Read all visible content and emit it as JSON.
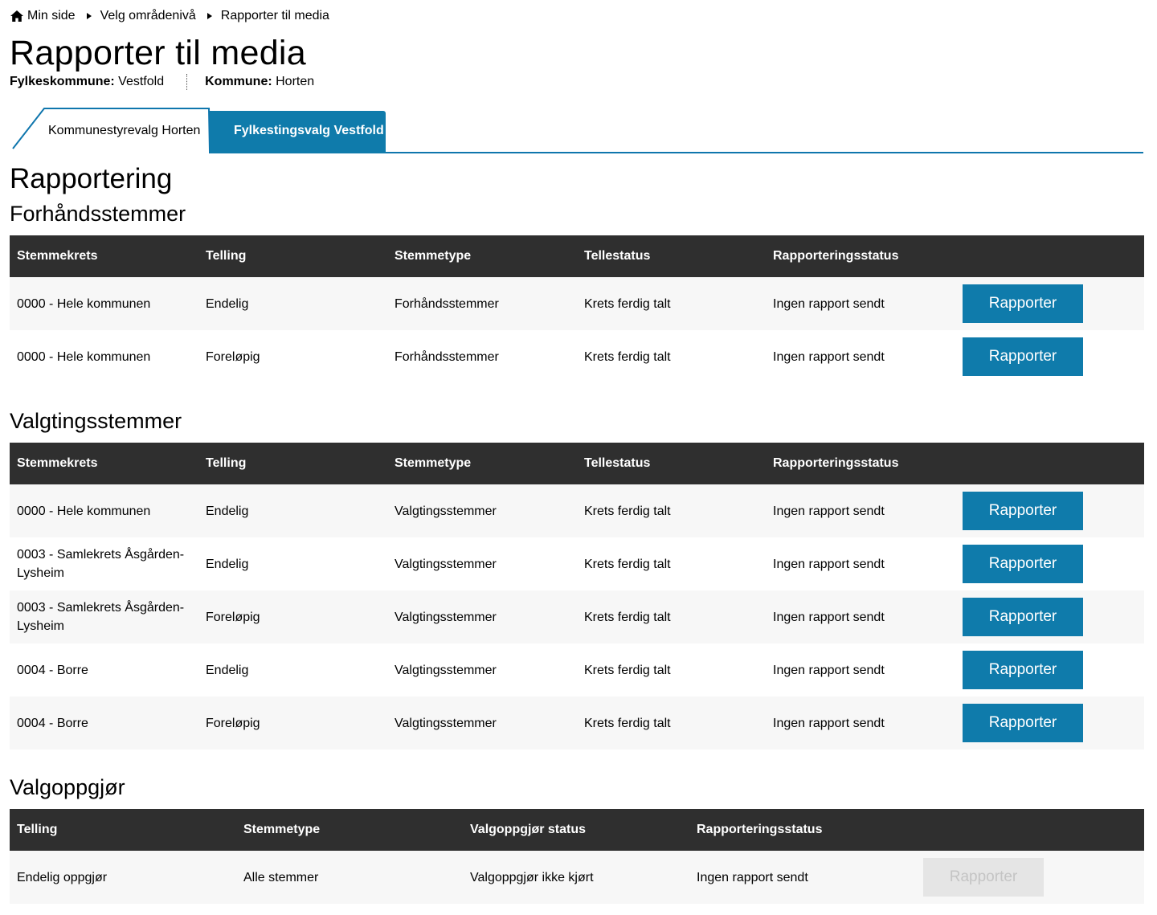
{
  "breadcrumb": {
    "items": [
      {
        "label": "Min side",
        "icon": "home-icon"
      },
      {
        "label": "Velg områdenivå"
      },
      {
        "label": "Rapporter til media"
      }
    ]
  },
  "page": {
    "title": "Rapporter til media",
    "meta": [
      {
        "label": "Fylkeskommune:",
        "value": "Vestfold"
      },
      {
        "label": "Kommune:",
        "value": "Horten"
      }
    ]
  },
  "tabs": [
    {
      "label": "Kommunestyrevalg Horten",
      "active": true
    },
    {
      "label": "Fylkestingsvalg Vestfold",
      "active": false
    }
  ],
  "colors": {
    "accent": "#0f7bab",
    "header_bg": "#2f2f2f",
    "row_alt": "#f7f7f7",
    "disabled_btn": "#e5e5e5"
  },
  "section": {
    "title": "Rapportering"
  },
  "forhand": {
    "title": "Forhåndsstemmer",
    "headers": [
      "Stemmekrets",
      "Telling",
      "Stemmetype",
      "Tellestatus",
      "Rapporteringsstatus"
    ],
    "rows": [
      {
        "krets": "0000 - Hele kommunen",
        "telling": "Endelig",
        "type": "Forhåndsstemmer",
        "status": "Krets ferdig talt",
        "rapport": "Ingen rapport sendt",
        "button": "Rapporter"
      },
      {
        "krets": "0000 - Hele kommunen",
        "telling": "Foreløpig",
        "type": "Forhåndsstemmer",
        "status": "Krets ferdig talt",
        "rapport": "Ingen rapport sendt",
        "button": "Rapporter"
      }
    ]
  },
  "valgting": {
    "title": "Valgtingsstemmer",
    "headers": [
      "Stemmekrets",
      "Telling",
      "Stemmetype",
      "Tellestatus",
      "Rapporteringsstatus"
    ],
    "rows": [
      {
        "krets": "0000 - Hele kommunen",
        "telling": "Endelig",
        "type": "Valgtingsstemmer",
        "status": "Krets ferdig talt",
        "rapport": "Ingen rapport sendt",
        "button": "Rapporter"
      },
      {
        "krets": "0003 - Samlekrets Åsgården-Lysheim",
        "telling": "Endelig",
        "type": "Valgtingsstemmer",
        "status": "Krets ferdig talt",
        "rapport": "Ingen rapport sendt",
        "button": "Rapporter"
      },
      {
        "krets": "0003 - Samlekrets Åsgården-Lysheim",
        "telling": "Foreløpig",
        "type": "Valgtingsstemmer",
        "status": "Krets ferdig talt",
        "rapport": "Ingen rapport sendt",
        "button": "Rapporter"
      },
      {
        "krets": "0004 - Borre",
        "telling": "Endelig",
        "type": "Valgtingsstemmer",
        "status": "Krets ferdig talt",
        "rapport": "Ingen rapport sendt",
        "button": "Rapporter"
      },
      {
        "krets": "0004 - Borre",
        "telling": "Foreløpig",
        "type": "Valgtingsstemmer",
        "status": "Krets ferdig talt",
        "rapport": "Ingen rapport sendt",
        "button": "Rapporter"
      }
    ]
  },
  "oppgjor": {
    "title": "Valgoppgjør",
    "headers": [
      "Telling",
      "Stemmetype",
      "Valgoppgjør status",
      "Rapporteringsstatus"
    ],
    "rows": [
      {
        "telling": "Endelig oppgjør",
        "type": "Alle stemmer",
        "status": "Valgoppgjør ikke kjørt",
        "rapport": "Ingen rapport sendt",
        "button": "Rapporter",
        "disabled": true
      }
    ]
  }
}
